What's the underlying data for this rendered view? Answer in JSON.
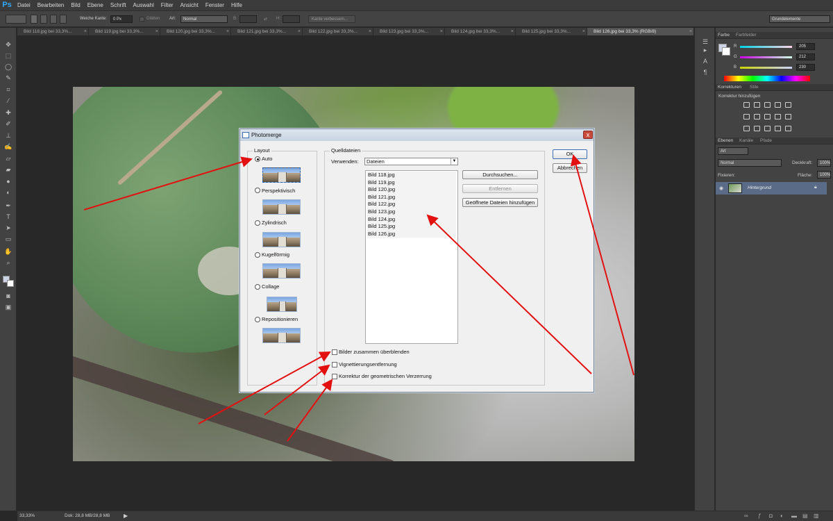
{
  "app": {
    "logo": "Ps"
  },
  "menu": [
    "Datei",
    "Bearbeiten",
    "Bild",
    "Ebene",
    "Schrift",
    "Auswahl",
    "Filter",
    "Ansicht",
    "Fenster",
    "Hilfe"
  ],
  "options_bar": {
    "feather_label": "Weiche Kante:",
    "feather_value": "0 Px",
    "antialias_label": "Glätten",
    "style_label": "Art:",
    "style_value": "Normal",
    "width_label": "B:",
    "height_label": "H:",
    "refine_edge_label": "Kante verbessern...",
    "workspace_value": "Grundelemente"
  },
  "tabs": [
    {
      "label": "Bild 118.jpg bei 33,3%...",
      "active": false
    },
    {
      "label": "Bild 119.jpg bei 33,3%...",
      "active": false
    },
    {
      "label": "Bild 120.jpg bei 33,3%...",
      "active": false
    },
    {
      "label": "Bild 121.jpg bei 33,3%...",
      "active": false
    },
    {
      "label": "Bild 122.jpg bei 33,3%...",
      "active": false
    },
    {
      "label": "Bild 123.jpg bei 33,3%...",
      "active": false
    },
    {
      "label": "Bild 124.jpg bei 33,3%...",
      "active": false
    },
    {
      "label": "Bild 125.jpg bei 33,3%...",
      "active": false
    },
    {
      "label": "Bild 126.jpg bei 33,3% (RGB/8)",
      "active": true
    }
  ],
  "tools": [
    "move-tool-icon",
    "marquee-tool-icon",
    "lasso-tool-icon",
    "quick-select-tool-icon",
    "crop-tool-icon",
    "eyedropper-tool-icon",
    "healing-brush-icon",
    "brush-tool-icon",
    "clone-stamp-icon",
    "history-brush-icon",
    "eraser-tool-icon",
    "gradient-tool-icon",
    "blur-tool-icon",
    "dodge-tool-icon",
    "pen-tool-icon",
    "type-tool-icon",
    "path-select-icon",
    "shape-tool-icon",
    "hand-tool-icon",
    "zoom-tool-icon"
  ],
  "color_panel": {
    "tab_color": "Farbe",
    "tab_swatches": "Farbfelder",
    "r_label": "R",
    "r_value": "205",
    "g_label": "G",
    "g_value": "212",
    "b_label": "B",
    "b_value": "230"
  },
  "adjustments_panel": {
    "tab_adjustments": "Korrekturen",
    "tab_styles": "Stile",
    "heading": "Korrektur hinzufügen"
  },
  "layers_panel": {
    "tab_layers": "Ebenen",
    "tab_channels": "Kanäle",
    "tab_paths": "Pfade",
    "filter_value": "Art",
    "blend_mode": "Normal",
    "opacity_label": "Deckkraft:",
    "opacity_value": "100%",
    "lock_label": "Fixieren:",
    "fill_label": "Fläche:",
    "fill_value": "100%",
    "layer_name": "Hintergrund"
  },
  "status_bar": {
    "zoom": "33,33%",
    "doc_info": "Dok: 28,8 MB/28,8 MB"
  },
  "dialog": {
    "title": "Photomerge",
    "layout_label": "Layout",
    "layout_options": [
      "Auto",
      "Perspektivisch",
      "Zylindrisch",
      "Kugelförmig",
      "Collage",
      "Repositionieren"
    ],
    "layout_selected": "Auto",
    "source_label": "Quelldateien",
    "use_label": "Verwenden:",
    "use_value": "Dateien",
    "files": [
      "Bild 118.jpg",
      "Bild 119.jpg",
      "Bild 120.jpg",
      "Bild 121.jpg",
      "Bild 122.jpg",
      "Bild 123.jpg",
      "Bild 124.jpg",
      "Bild 125.jpg",
      "Bild 126.jpg"
    ],
    "browse_button": "Durchsuchen...",
    "remove_button": "Entfernen",
    "add_open_button": "Geöffnete Dateien hinzufügen",
    "ok_button": "OK",
    "cancel_button": "Abbrechen",
    "checkboxes": [
      "Bilder zusammen überblenden",
      "Vignettierungsentfernung",
      "Korrektur der geometrischen Verzerrung"
    ],
    "close_glyph": "x"
  },
  "colors": {
    "annotation_arrow": "#e31010",
    "selected_layer": "#596b86",
    "ui_background": "#282828"
  }
}
